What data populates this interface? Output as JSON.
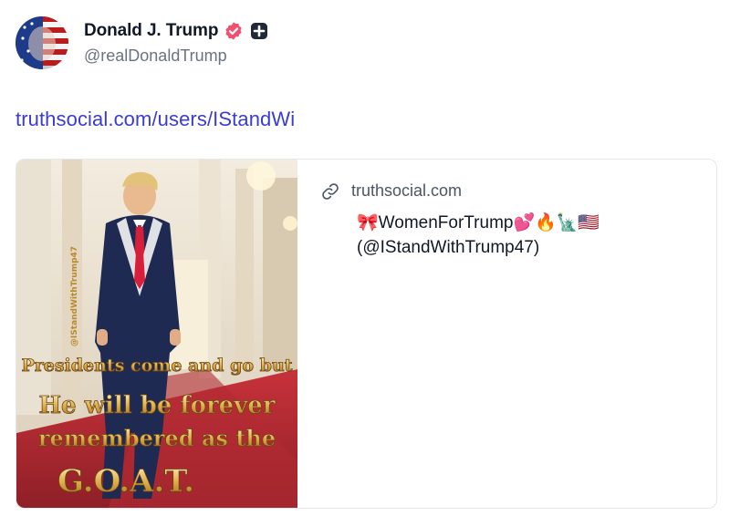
{
  "post": {
    "author": {
      "display_name": "Donald J. Trump",
      "handle": "@realDonaldTrump"
    },
    "link_text": "truthsocial.com/users/IStandWi",
    "card": {
      "domain": "truthsocial.com",
      "title_line1": "🎀WomenForTrump💕🔥🗽🇺🇸",
      "title_line2": "(@IStandWithTrump47)",
      "image": {
        "overlay_line1": "Presidents come and go but",
        "overlay_line2": "He will be forever",
        "overlay_line3": "remembered as the",
        "overlay_line4": "G.O.A.T.",
        "watermark": "@IStandWithTrump47"
      }
    }
  },
  "colors": {
    "link": "#3b3bd6",
    "verified_badge": "#f0506e",
    "muted_text": "#6b7280",
    "card_border": "#e5e7eb"
  },
  "icons": [
    "avatar-image",
    "verified-icon",
    "plus-badge-icon",
    "link-icon"
  ]
}
